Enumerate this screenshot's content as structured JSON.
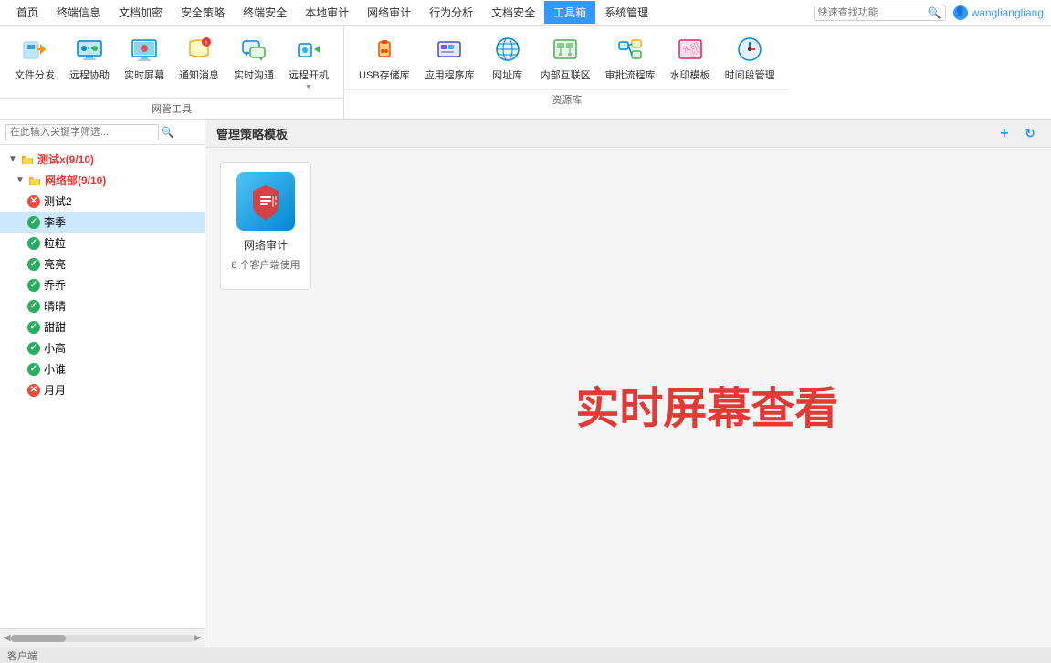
{
  "menubar": {
    "items": [
      {
        "label": "首页",
        "active": false
      },
      {
        "label": "终端信息",
        "active": false
      },
      {
        "label": "文档加密",
        "active": false
      },
      {
        "label": "安全策略",
        "active": false
      },
      {
        "label": "终端安全",
        "active": false
      },
      {
        "label": "本地审计",
        "active": false
      },
      {
        "label": "网络审计",
        "active": false
      },
      {
        "label": "行为分析",
        "active": false
      },
      {
        "label": "文档安全",
        "active": false
      },
      {
        "label": "工具箱",
        "active": true
      },
      {
        "label": "系统管理",
        "active": false
      }
    ],
    "search_placeholder": "快速查找功能",
    "user": "wangliangliang"
  },
  "toolbar": {
    "sections": [
      {
        "label": "网管工具",
        "items": [
          {
            "id": "file-dist",
            "label": "文件分发",
            "icon": "file-dist"
          },
          {
            "id": "remote-help",
            "label": "远程协助",
            "icon": "remote-help"
          },
          {
            "id": "realtime-screen",
            "label": "实时屏幕",
            "icon": "realtime-screen"
          },
          {
            "id": "notify-msg",
            "label": "通知消息",
            "icon": "notify-msg"
          },
          {
            "id": "realtime-chat",
            "label": "实时沟通",
            "icon": "realtime-chat"
          },
          {
            "id": "remote-boot",
            "label": "远程开机",
            "icon": "remote-boot"
          }
        ]
      },
      {
        "label": "资源库",
        "items": [
          {
            "id": "usb-storage",
            "label": "USB存储库",
            "icon": "usb-storage"
          },
          {
            "id": "app-repo",
            "label": "应用程序库",
            "icon": "app-repo"
          },
          {
            "id": "website-repo",
            "label": "网址库",
            "icon": "website-repo"
          },
          {
            "id": "intranet-zone",
            "label": "内部互联区",
            "icon": "intranet-zone"
          },
          {
            "id": "approval-flow",
            "label": "审批流程库",
            "icon": "approval-flow"
          },
          {
            "id": "watermark",
            "label": "水印模板",
            "icon": "watermark"
          },
          {
            "id": "time-period",
            "label": "时间段管理",
            "icon": "time-period"
          }
        ]
      }
    ]
  },
  "sidebar": {
    "search_placeholder": "在此输入关键字筛选...",
    "tree": [
      {
        "id": "root",
        "label": "测试x(9/10)",
        "indent": 0,
        "type": "group",
        "expanded": true,
        "icon": "folder"
      },
      {
        "id": "net-dept",
        "label": "网络部(9/10)",
        "indent": 1,
        "type": "group",
        "expanded": true,
        "icon": "folder"
      },
      {
        "id": "test2",
        "label": "测试2",
        "indent": 2,
        "type": "node",
        "status": "err"
      },
      {
        "id": "liji",
        "label": "李季",
        "indent": 2,
        "type": "node",
        "status": "ok",
        "selected": true
      },
      {
        "id": "liuli",
        "label": "粒粒",
        "indent": 2,
        "type": "node",
        "status": "ok"
      },
      {
        "id": "liangliang",
        "label": "亮亮",
        "indent": 2,
        "type": "node",
        "status": "ok"
      },
      {
        "id": "qiaoqiao",
        "label": "乔乔",
        "indent": 2,
        "type": "node",
        "status": "ok"
      },
      {
        "id": "jingbing",
        "label": "晴晴",
        "indent": 2,
        "type": "node",
        "status": "ok"
      },
      {
        "id": "tiantian",
        "label": "甜甜",
        "indent": 2,
        "type": "node",
        "status": "ok"
      },
      {
        "id": "xiaogao",
        "label": "小高",
        "indent": 2,
        "type": "node",
        "status": "ok"
      },
      {
        "id": "xiaosheng",
        "label": "小谁",
        "indent": 2,
        "type": "node",
        "status": "ok"
      },
      {
        "id": "yueyue",
        "label": "月月",
        "indent": 2,
        "type": "node",
        "status": "err"
      }
    ],
    "bottom_label": "客户端"
  },
  "content": {
    "header_title": "管理策略模板",
    "add_btn": "+",
    "refresh_btn": "↻",
    "policy_cards": [
      {
        "id": "net-audit",
        "name": "网络审计",
        "info": "8 个客户端使用"
      }
    ],
    "big_text": "实时屏幕查看"
  }
}
